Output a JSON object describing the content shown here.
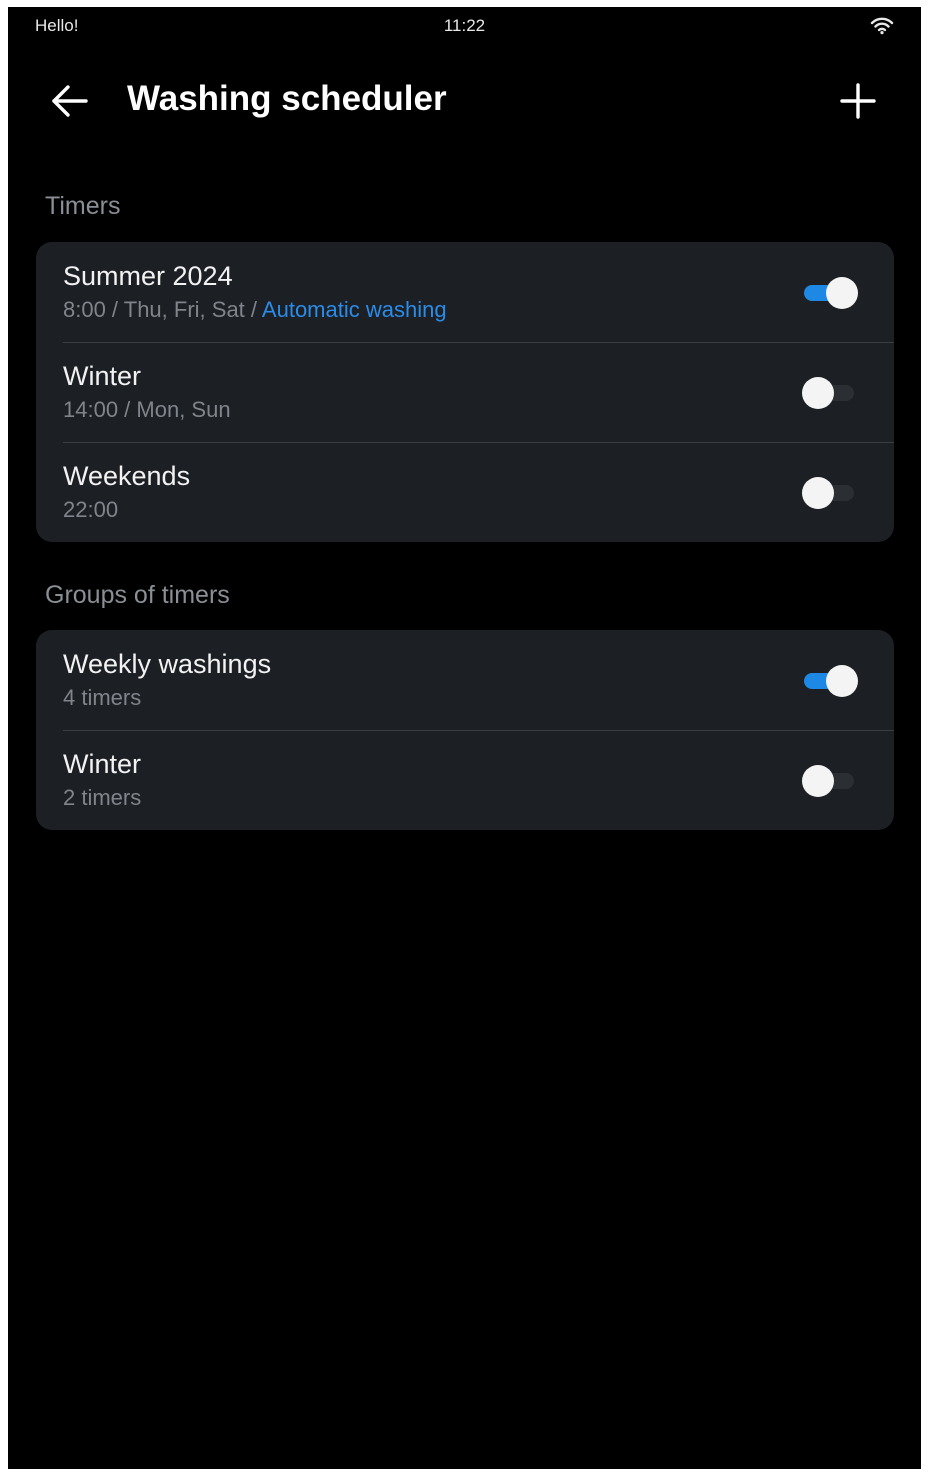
{
  "status_bar": {
    "left_text": "Hello!",
    "time": "11:22",
    "wifi_icon": "wifi-icon"
  },
  "app_bar": {
    "title": "Washing scheduler",
    "back_icon": "arrow-left-icon",
    "add_icon": "plus-icon"
  },
  "timers": {
    "header": "Timers",
    "items": [
      {
        "title": "Summer 2024",
        "subtitle_plain": "8:00 / Thu, Fri, Sat / ",
        "subtitle_accent": "Automatic washing",
        "enabled": true
      },
      {
        "title": "Winter",
        "subtitle_plain": "14:00 / Mon, Sun",
        "subtitle_accent": "",
        "enabled": false
      },
      {
        "title": "Weekends",
        "subtitle_plain": "22:00",
        "subtitle_accent": "",
        "enabled": false
      }
    ]
  },
  "groups": {
    "header": "Groups of timers",
    "items": [
      {
        "title": "Weekly washings",
        "subtitle_plain": "4 timers",
        "subtitle_accent": "",
        "enabled": true
      },
      {
        "title": "Winter",
        "subtitle_plain": "2 timers",
        "subtitle_accent": "",
        "enabled": false
      }
    ]
  },
  "colors": {
    "background": "#000000",
    "card": "#1c1f24",
    "accent": "#1e88e5",
    "link": "#2a8ce8",
    "secondary_text": "#80848b"
  }
}
